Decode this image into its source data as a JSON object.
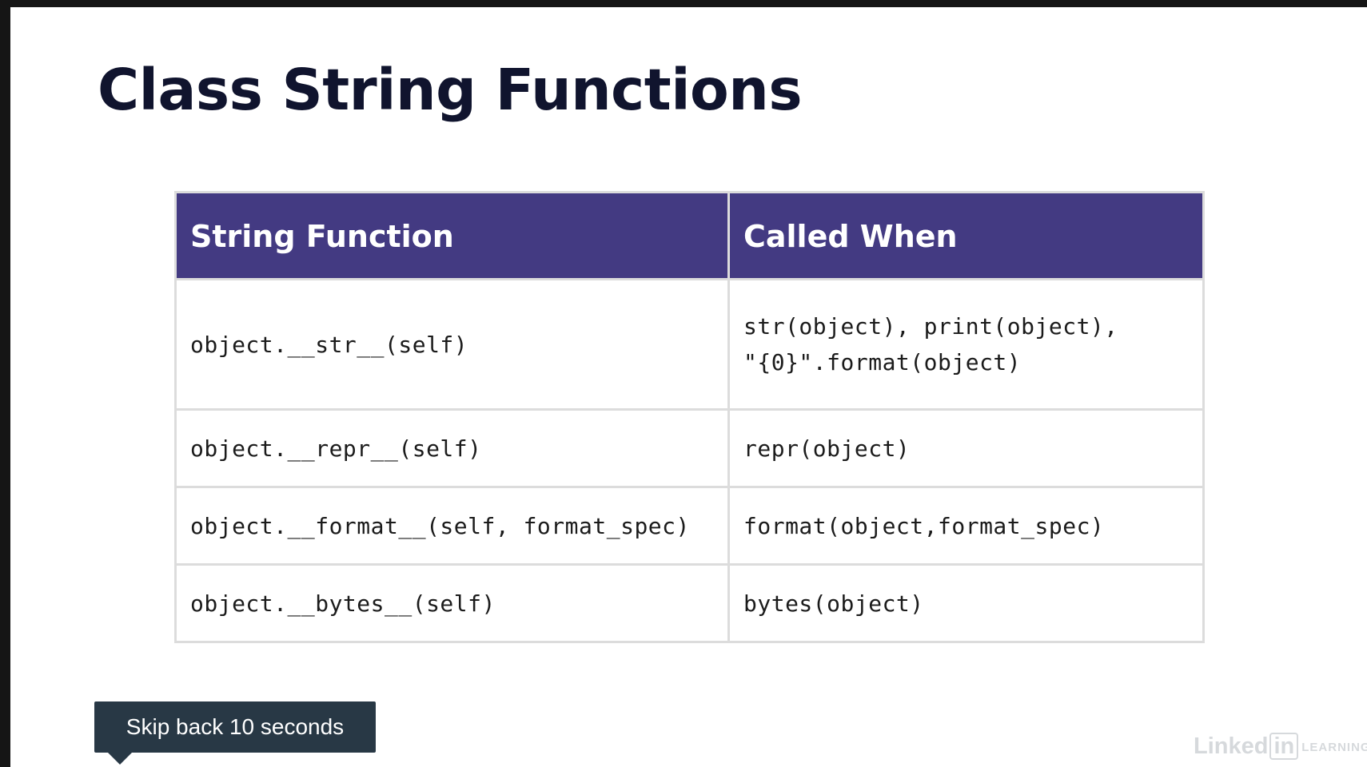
{
  "slide": {
    "title": "Class String Functions"
  },
  "table": {
    "headers": [
      "String Function",
      "Called When"
    ],
    "rows": [
      {
        "function": "object.__str__(self)",
        "called_when": [
          "str(object), print(object),",
          "\"{0}\".format(object)"
        ]
      },
      {
        "function": "object.__repr__(self)",
        "called_when": [
          "repr(object)"
        ]
      },
      {
        "function": "object.__format__(self, format_spec)",
        "called_when": [
          "format(object,format_spec)"
        ]
      },
      {
        "function": "object.__bytes__(self)",
        "called_when": [
          "bytes(object)"
        ]
      }
    ]
  },
  "tooltip": {
    "text": "Skip back 10 seconds"
  },
  "watermark": {
    "brand": "Linked",
    "brand_box": "in",
    "sub": "LEARNING"
  },
  "colors": {
    "header_bg": "#433a82",
    "title_color": "#10142e",
    "tooltip_bg": "#283845"
  }
}
